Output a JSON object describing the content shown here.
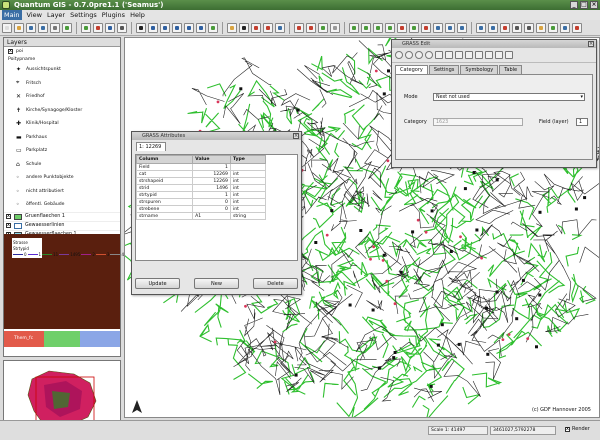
{
  "window": {
    "title": "Quantum GIS - 0.7.0pre1.1 ('Seamus')"
  },
  "menu": [
    "Main",
    "View",
    "Layer",
    "Settings",
    "Plugins",
    "Help"
  ],
  "layers": {
    "header": "Layers",
    "title": "poi",
    "subtitle": "Poitypname",
    "items": [
      "Aussichtspunkt",
      "Fritsch",
      "Friedhof",
      "Kirche/Synagoge/Kloster",
      "Klinik/Hospital",
      "Parkhaus",
      "Parkplatz",
      "Schule",
      "andere Punktobjekte",
      "nicht attributiert",
      "öffentl. Gebäude"
    ],
    "groups": [
      "Gruenflaechen 1",
      "Gewaesserlinien",
      "Gewaesserflaechen 1"
    ],
    "lines_layer": {
      "name": "Strasse",
      "field": "Strtypid",
      "values": [
        "0",
        "1",
        "11",
        "1495",
        "2",
        "3",
        "4",
        "5",
        "6",
        "7"
      ]
    },
    "bottom_layer": "Them_fc",
    "colors": {
      "poly_brown": "#5a1f0e",
      "bar1": "#e25a4a",
      "bar2": "#6fcf6a",
      "bar3": "#8ba6e6"
    }
  },
  "attribute_dialog": {
    "title": "GRASS Attributes",
    "tab": "1: 12269",
    "columns": [
      "Column",
      "Value",
      "Type"
    ],
    "rows": [
      {
        "column": "Field",
        "value": "1",
        "type": ""
      },
      {
        "column": "cat",
        "value": "12269",
        "type": "int"
      },
      {
        "column": "strshapeid",
        "value": "12269",
        "type": "int"
      },
      {
        "column": "strid",
        "value": "1496",
        "type": "int"
      },
      {
        "column": "strtypid",
        "value": "1",
        "type": "int"
      },
      {
        "column": "strspuren",
        "value": "0",
        "type": "int"
      },
      {
        "column": "strebene",
        "value": "0",
        "type": "int"
      },
      {
        "column": "strname",
        "value": "A1",
        "type": "string"
      }
    ],
    "buttons": {
      "update": "Update",
      "new": "New",
      "delete": "Delete"
    }
  },
  "grass_edit": {
    "title": "GRASS Edit",
    "tabs": [
      "Category",
      "Settings",
      "Symbology",
      "Table"
    ],
    "mode_label": "Mode",
    "mode_value": "Next not used",
    "category_label": "Category",
    "category_value": "1623",
    "field_label": "Field (layer)",
    "field_value": "1"
  },
  "map": {
    "copyright": "(c) GDF Hannover 2005"
  },
  "status": {
    "scale": "Scale 1: 41497",
    "coords": "3461027,5792278",
    "render": "Render"
  }
}
